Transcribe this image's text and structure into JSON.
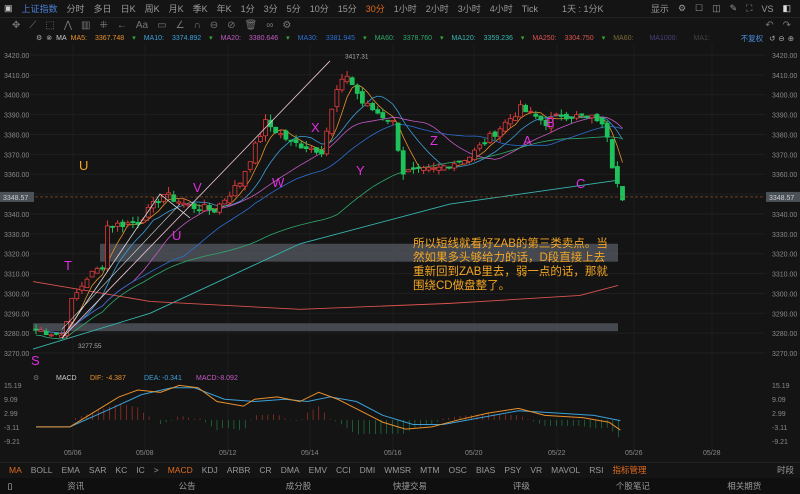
{
  "topbar": {
    "title": "上证指数",
    "periods": [
      "分时",
      "多日",
      "日K",
      "周K",
      "月K",
      "季K",
      "年K",
      "1分",
      "3分",
      "5分",
      "10分",
      "15分",
      "30分",
      "1小时",
      "2小时",
      "3小时",
      "4小时",
      "Tick"
    ],
    "active": "30分",
    "range": "1天 : 1分K",
    "display": "显示",
    "vs": "VS"
  },
  "ma_bar": {
    "label": "MA",
    "items": [
      {
        "name": "MA5:",
        "value": "3367.748",
        "color": "#e8912d"
      },
      {
        "name": "MA10:",
        "value": "3374.892",
        "color": "#3ba0d9"
      },
      {
        "name": "MA20:",
        "value": "3380.646",
        "color": "#c35ac4"
      },
      {
        "name": "MA30:",
        "value": "3381.945",
        "color": "#2c6fd1"
      },
      {
        "name": "MA60:",
        "value": "3378.760",
        "color": "#2fa86b"
      },
      {
        "name": "MA120:",
        "value": "3359.236",
        "color": "#36b6b0"
      },
      {
        "name": "MA250:",
        "value": "3304.750",
        "color": "#d9534f"
      },
      {
        "name": "MA60:",
        "value": "",
        "color": "#7a6a3a"
      },
      {
        "name": "MA1000:",
        "value": "",
        "color": "#4a3f7a"
      },
      {
        "name": "MA1:",
        "value": "",
        "color": "#444"
      }
    ],
    "adjust": "不复权"
  },
  "chart_data": {
    "type": "candlestick",
    "price_ticks": [
      "3420.00",
      "3410.00",
      "3400.00",
      "3390.00",
      "3380.00",
      "3370.00",
      "3360.00",
      "3350.00",
      "3340.00",
      "3330.00",
      "3320.00",
      "3310.00",
      "3300.00",
      "3290.00",
      "3280.00",
      "3270.00"
    ],
    "ylim": [
      3270,
      3420
    ],
    "current_price": "3348.57",
    "high_label": "3417.31",
    "low_label": "3277.55",
    "x_ticks": [
      "05/06",
      "05/08",
      "05/12",
      "05/14",
      "05/16",
      "05/20",
      "05/22",
      "05/26",
      "05/28"
    ],
    "close_waypoints": [
      [
        0,
        3282
      ],
      [
        5,
        3279
      ],
      [
        7,
        3296
      ],
      [
        10,
        3308
      ],
      [
        13,
        3314
      ],
      [
        14,
        3334
      ],
      [
        20,
        3336
      ],
      [
        25,
        3350
      ],
      [
        30,
        3344
      ],
      [
        35,
        3342
      ],
      [
        40,
        3356
      ],
      [
        45,
        3386
      ],
      [
        50,
        3376
      ],
      [
        56,
        3372
      ],
      [
        59,
        3402
      ],
      [
        61,
        3410
      ],
      [
        64,
        3396
      ],
      [
        70,
        3386
      ],
      [
        72,
        3361
      ],
      [
        78,
        3362
      ],
      [
        85,
        3369
      ],
      [
        90,
        3381
      ],
      [
        95,
        3393
      ],
      [
        100,
        3386
      ],
      [
        103,
        3390
      ],
      [
        110,
        3388
      ],
      [
        112,
        3380
      ],
      [
        113,
        3365
      ],
      [
        115,
        3349
      ]
    ],
    "zones": [
      {
        "top": 3325,
        "bottom": 3316
      },
      {
        "top": 3285,
        "bottom": 3281
      }
    ],
    "wave_labels": [
      {
        "t": "S",
        "c": "#e02ee0"
      },
      {
        "t": "T",
        "c": "#e02ee0"
      },
      {
        "t": "U",
        "c": "#f5a623"
      },
      {
        "t": "U",
        "c": "#e02ee0"
      },
      {
        "t": "V",
        "c": "#e02ee0"
      },
      {
        "t": "W",
        "c": "#e02ee0"
      },
      {
        "t": "X",
        "c": "#e02ee0"
      },
      {
        "t": "Y",
        "c": "#e02ee0"
      },
      {
        "t": "Z",
        "c": "#e02ee0"
      },
      {
        "t": "A",
        "c": "#e02ee0"
      },
      {
        "t": "B",
        "c": "#e02ee0"
      },
      {
        "t": "C",
        "c": "#e02ee0"
      }
    ]
  },
  "annotation": "所以短线就看好ZAB的第三类卖点。当然如果多头够给力的话，D段直接上去重新回到ZAB里去，弱一点的话，那就围绕CD做盘整了。",
  "macd": {
    "label": "MACD",
    "dif": "-4.387",
    "dea": "-0.341",
    "macd": "-8.092",
    "ticks": [
      "15.19",
      "9.09",
      "2.99",
      "-3.11",
      "-9.21"
    ],
    "dif_label": "DIF:",
    "dea_label": "DEA:",
    "macd_label": "MACD:"
  },
  "indicator_tabs": [
    "MA",
    "BOLL",
    "EMA",
    "SAR",
    "KC",
    "IC",
    ">",
    "MACD",
    "KDJ",
    "ARBR",
    "CR",
    "DMA",
    "EMV",
    "CCI",
    "DMI",
    "WMSR",
    "MTM",
    "OSC",
    "BIAS",
    "PSY",
    "VR",
    "MAVOL",
    "RSI",
    "指标管理"
  ],
  "period_tab": "时段",
  "footer": [
    "资讯",
    "公告",
    "成分股",
    "快捷交易",
    "评级",
    "个股笔记",
    "相关期货"
  ]
}
